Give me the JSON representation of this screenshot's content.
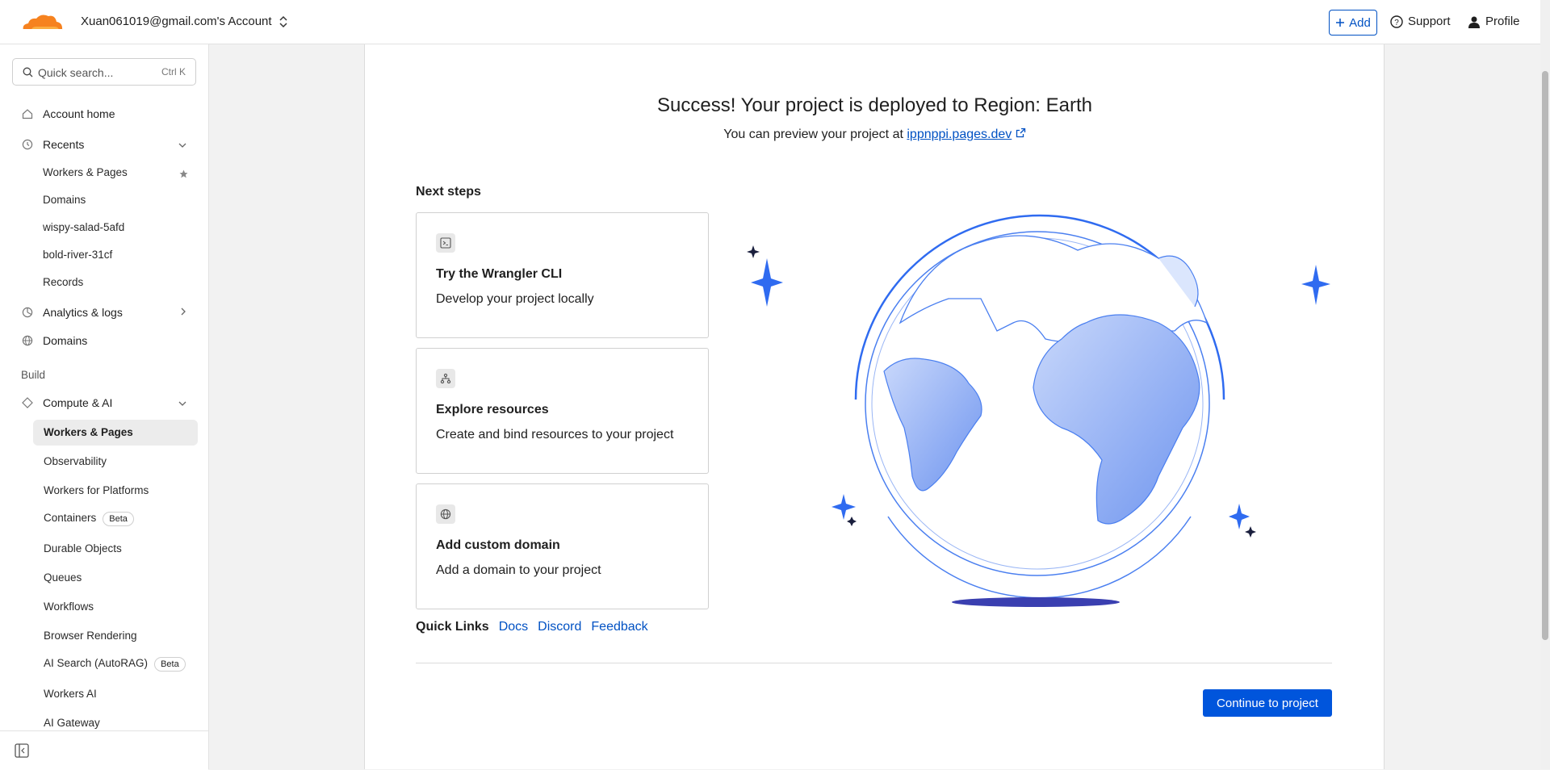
{
  "topbar": {
    "account_name": "Xuan061019@gmail.com's Account",
    "add_label": "Add",
    "support_label": "Support",
    "profile_label": "Profile"
  },
  "sidebar": {
    "search_placeholder": "Quick search...",
    "search_shortcut": "Ctrl K",
    "account_home": "Account home",
    "recents": "Recents",
    "recent_items": [
      "Workers & Pages",
      "Domains",
      "wispy-salad-5afd",
      "bold-river-31cf",
      "Records"
    ],
    "analytics": "Analytics & logs",
    "domains": "Domains",
    "build_section": "Build",
    "compute_ai": "Compute & AI",
    "compute_items": [
      "Workers & Pages",
      "Observability",
      "Workers for Platforms",
      "Containers",
      "Durable Objects",
      "Queues",
      "Workflows",
      "Browser Rendering",
      "AI Search (AutoRAG)",
      "Workers AI",
      "AI Gateway"
    ],
    "beta_label": "Beta"
  },
  "main": {
    "headline": "Success! Your project is deployed to Region: Earth",
    "preview_text": "You can preview your project at",
    "preview_link": "ippnppi.pages.dev",
    "next_steps": "Next steps",
    "steps": [
      {
        "title": "Try the Wrangler CLI",
        "desc": "Develop your project locally"
      },
      {
        "title": "Explore resources",
        "desc": "Create and bind resources to your project"
      },
      {
        "title": "Add custom domain",
        "desc": "Add a domain to your project"
      }
    ],
    "quick_links_label": "Quick Links",
    "quick_links": [
      "Docs",
      "Discord",
      "Feedback"
    ],
    "continue_label": "Continue to project"
  },
  "colors": {
    "accent": "#0051c3",
    "button": "#0055dc",
    "brand_orange": "#f6821f"
  }
}
